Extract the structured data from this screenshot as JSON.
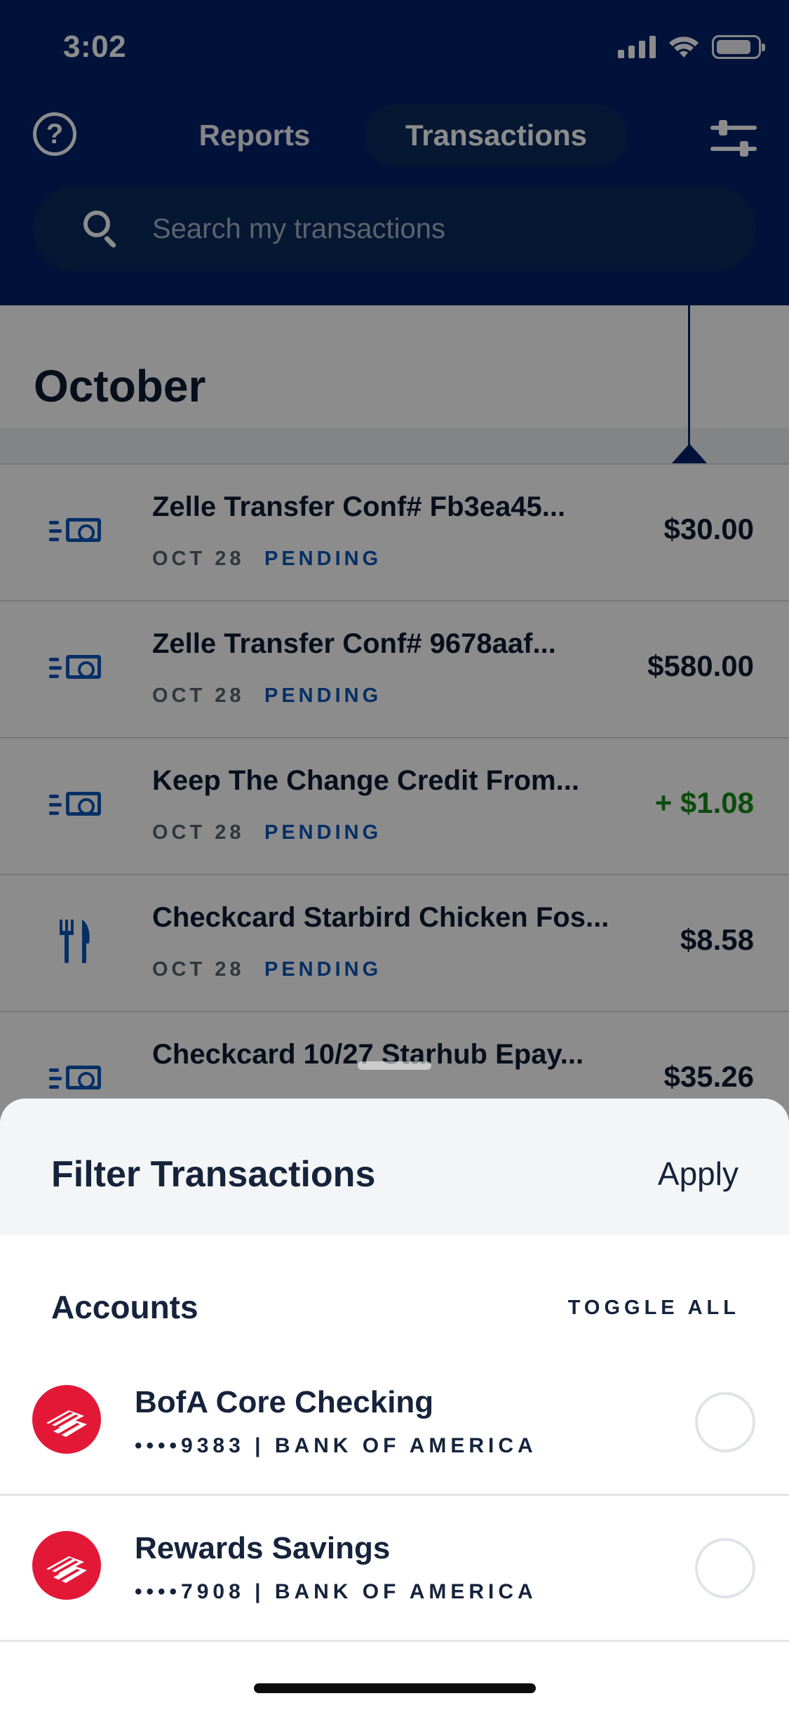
{
  "status_bar": {
    "time": "3:02"
  },
  "header": {
    "help_icon": "question-circle-icon",
    "tabs": [
      {
        "label": "Reports",
        "selected": false
      },
      {
        "label": "Transactions",
        "selected": true
      }
    ],
    "filter_icon": "sliders-icon",
    "search": {
      "placeholder": "Search my transactions",
      "value": ""
    }
  },
  "list": {
    "month": "October",
    "transactions": [
      {
        "name": "Zelle Transfer Conf# Fb3ea45...",
        "date": "OCT 28",
        "status": "PENDING",
        "amount": "$30.00",
        "icon": "money-transfer-icon",
        "credit": false
      },
      {
        "name": "Zelle Transfer Conf# 9678aaf...",
        "date": "OCT 28",
        "status": "PENDING",
        "amount": "$580.00",
        "icon": "money-transfer-icon",
        "credit": false
      },
      {
        "name": "Keep The Change Credit From...",
        "date": "OCT 28",
        "status": "PENDING",
        "amount": "+ $1.08",
        "icon": "money-transfer-icon",
        "credit": true
      },
      {
        "name": "Checkcard Starbird Chicken Fos...",
        "date": "OCT 28",
        "status": "PENDING",
        "amount": "$8.58",
        "icon": "fork-knife-icon",
        "credit": false
      },
      {
        "name": "Checkcard 10/27 Starhub Epay...",
        "date": "",
        "status": "",
        "amount": "$35.26",
        "icon": "money-transfer-icon",
        "credit": false
      }
    ]
  },
  "sheet": {
    "title": "Filter Transactions",
    "apply_label": "Apply",
    "accounts_label": "Accounts",
    "toggle_all_label": "TOGGLE ALL",
    "accounts": [
      {
        "name": "BofA Core Checking",
        "meta": "••••9383 | BANK OF AMERICA",
        "selected": false
      },
      {
        "name": "Rewards Savings",
        "meta": "••••7908 | BANK OF AMERICA",
        "selected": false
      }
    ]
  },
  "colors": {
    "header_bg": "#012169",
    "accent_blue": "#0a56b8",
    "credit_green": "#178a18",
    "bofa_red": "#e31837"
  }
}
